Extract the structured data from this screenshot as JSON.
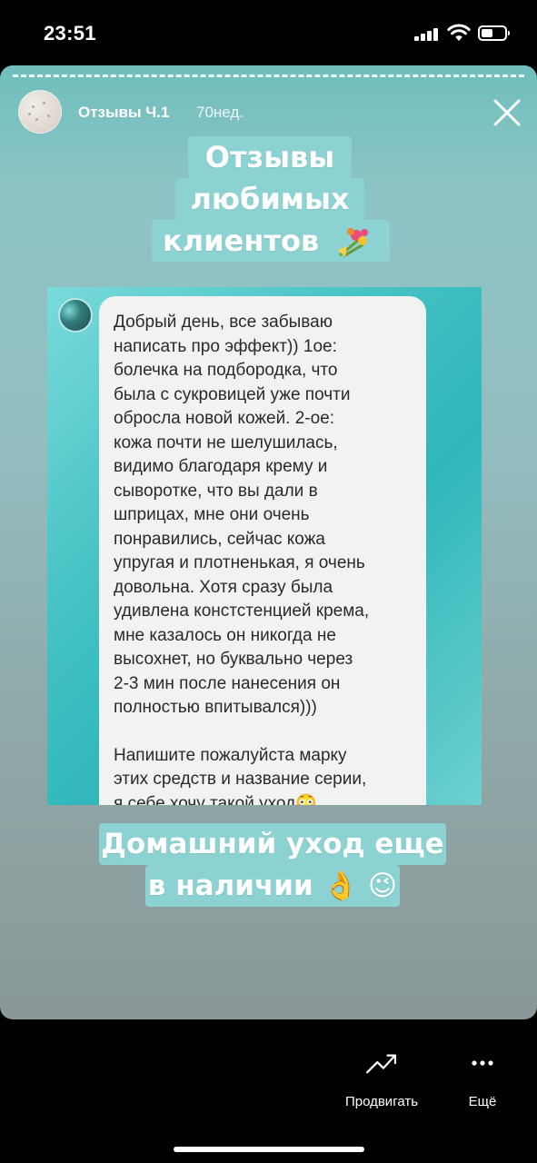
{
  "status_bar": {
    "time": "23:51"
  },
  "story": {
    "title": "Отзывы Ч.1",
    "age": "70нед.",
    "heading_lines": [
      "Отзывы",
      "любимых",
      "клиентов"
    ],
    "footer_lines": [
      "Домашний уход еще",
      "в наличии"
    ],
    "emoji_ok": "👌",
    "emoji_wink": "😉"
  },
  "message": {
    "paragraph_1": "Добрый день, все забываю\nнаписать про эффект)) 1ое:\nболечка на подбородка, что\nбыла с сукровицей уже почти\nобросла новой кожей. 2-ое:\nкожа почти не шелушилась,\nвидимо благодаря крему и\nсыворотке, что вы дали в\nшприцах, мне они очень\nпонравились, сейчас кожа\nупругая и плотненькая, я очень\nдовольна. Хотя сразу была\nудивлена констстенцией крема,\nмне казалось он никогда не\nвысохнет, но буквально через\n2-3 мин после нанесения он\nполностью впитывался)))",
    "paragraph_2": "Напишите пожалуйста марку\nэтих средств и название серии,\nя себе хочу такой уход😳"
  },
  "actions": {
    "promote_label": "Продвигать",
    "more_label": "Ещё"
  }
}
